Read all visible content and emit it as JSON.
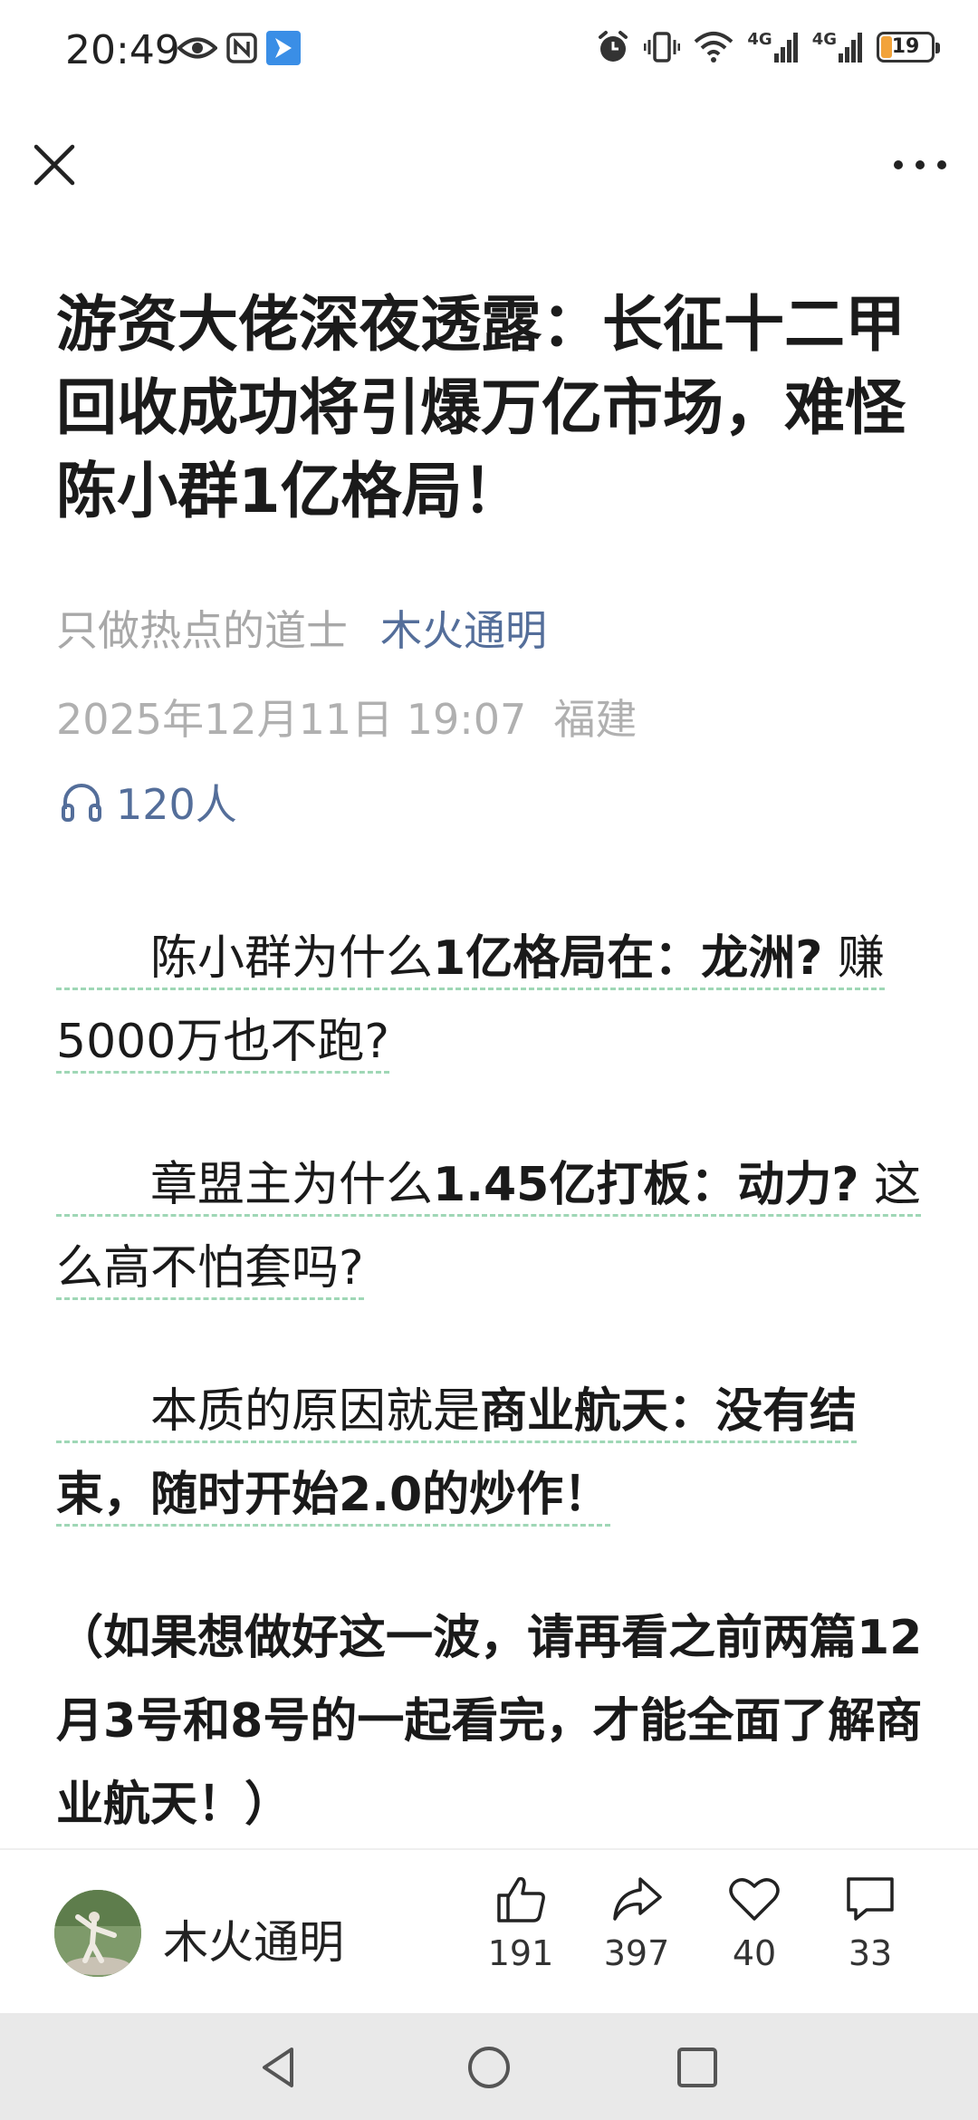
{
  "status_bar": {
    "time": "20:49",
    "network_1": "4G",
    "network_2": "4G",
    "battery": "19"
  },
  "toolbar": {
    "close_icon": "close-icon",
    "more_icon": "more-icon"
  },
  "article": {
    "title": "游资大佬深夜透露：长征十二甲回收成功将引爆万亿市场，难怪陈小群1亿格局！",
    "source": "只做热点的道士",
    "author": "木火通明",
    "datetime": "2025年12月11日 19:07",
    "location": "福建",
    "listeners": "120人",
    "paragraphs": [
      {
        "indent": "　　",
        "plain": "陈小群为什么",
        "bold": "1亿格局在：龙洲?",
        "rest": " 赚5000万也不跑?"
      },
      {
        "indent": "　　",
        "plain": "章盟主为什么",
        "bold": "1.45亿打板：动力?",
        "rest": " 这么高不怕套吗?"
      },
      {
        "indent": "　　",
        "plain": "本质的原因就是",
        "bold": "商业航天：没有结束",
        "rest_bold": "，随时开始2.0的炒作！"
      },
      {
        "text": "（如果想做好这一波，请再看之前两篇12月3号和8号的一起看完，才能全面了解商业航天！）"
      }
    ]
  },
  "action_bar": {
    "author_name": "木火通明",
    "likes": "191",
    "shares": "397",
    "favorites": "40",
    "comments": "33"
  },
  "colors": {
    "accent": "#546e9a",
    "meta_gray": "#a8a8a8",
    "underline_green": "#9fd7b6",
    "battery": "#f2a33a"
  }
}
